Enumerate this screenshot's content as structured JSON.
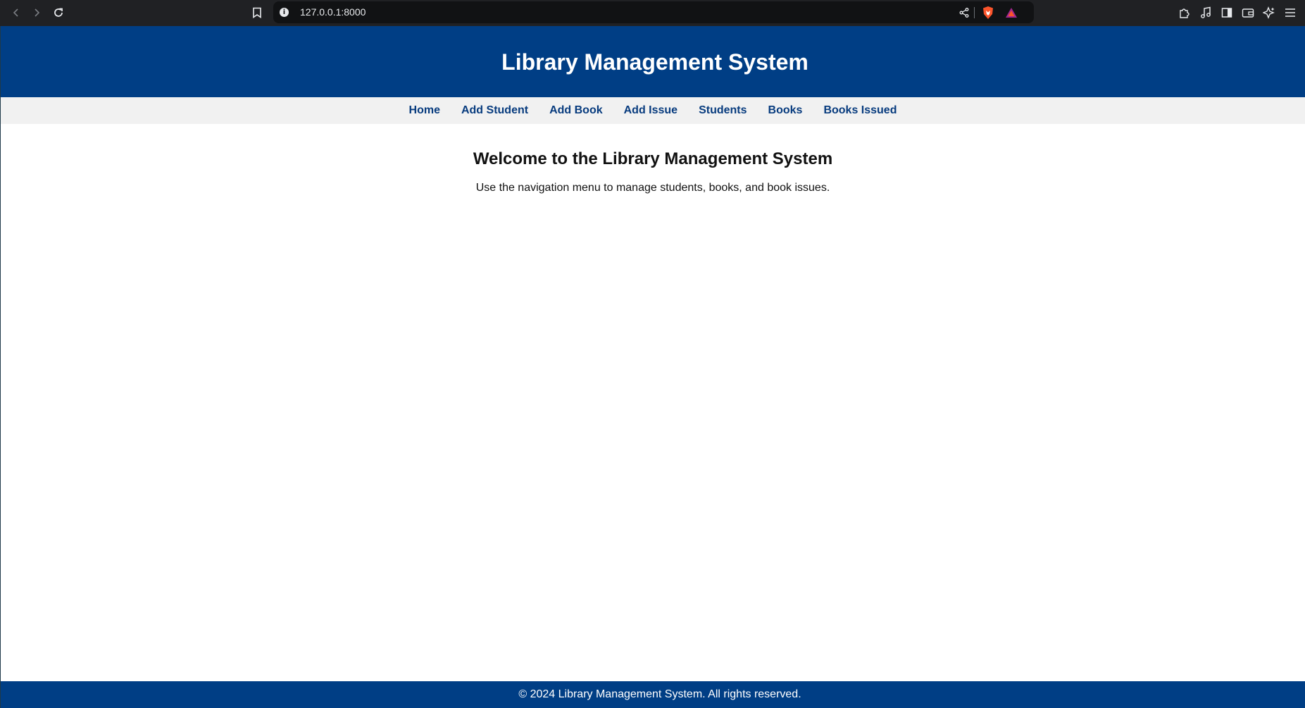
{
  "browser": {
    "url": "127.0.0.1:8000",
    "icons": [
      "back-icon",
      "forward-icon",
      "reload-icon",
      "bookmark-icon",
      "info-icon",
      "share-icon",
      "brave-shield-icon",
      "brave-rewards-icon",
      "extensions-icon",
      "media-icon",
      "sidebar-icon",
      "wallet-icon",
      "leo-ai-icon",
      "menu-icon"
    ]
  },
  "header": {
    "title": "Library Management System"
  },
  "nav": {
    "items": [
      {
        "label": "Home"
      },
      {
        "label": "Add Student"
      },
      {
        "label": "Add Book"
      },
      {
        "label": "Add Issue"
      },
      {
        "label": "Students"
      },
      {
        "label": "Books"
      },
      {
        "label": "Books Issued"
      }
    ]
  },
  "main": {
    "heading": "Welcome to the Library Management System",
    "text": "Use the navigation menu to manage students, books, and book issues."
  },
  "footer": {
    "text": "© 2024 Library Management System. All rights reserved."
  },
  "colors": {
    "header_bg": "#003e85",
    "nav_bg": "#f1f1f1",
    "nav_link": "#073b7e",
    "browser_bg": "#202124"
  }
}
